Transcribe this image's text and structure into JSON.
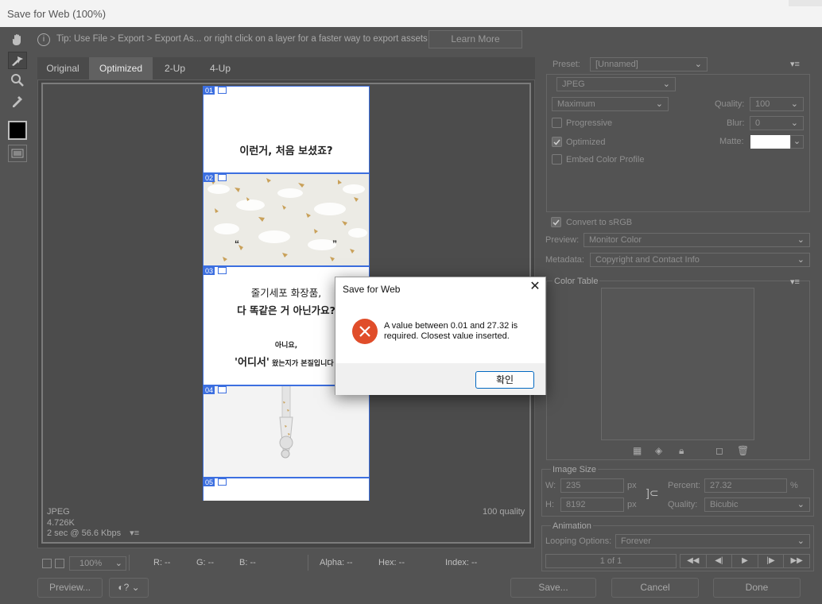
{
  "window": {
    "title": "Save for Web (100%)"
  },
  "tip": {
    "text": "Tip: Use File > Export > Export As...  or right click on a layer for a faster way to export assets",
    "learn_more": "Learn More"
  },
  "tabs": [
    "Original",
    "Optimized",
    "2-Up",
    "4-Up"
  ],
  "selected_tab": "Optimized",
  "canvas": {
    "slices": [
      "01",
      "02",
      "03",
      "04",
      "05"
    ],
    "text1": "이런거, 처음 보셨죠?",
    "text2a": "줄기세포 화장품,",
    "text2b": "다 똑같은 거 아닌가요?",
    "text3": "아니요,",
    "text4a": "'어디서'",
    "text4b": " 왔는지가 본질입니다",
    "quote_left": "“",
    "quote_right": "”"
  },
  "status": {
    "format": "JPEG",
    "size": "4.726K",
    "time": "2 sec @ 56.6 Kbps",
    "menu": "▾≡",
    "quality": "100 quality"
  },
  "bottom": {
    "zoom": "100%",
    "r": "R: --",
    "g": "G: --",
    "b": "B: --",
    "alpha": "Alpha: --",
    "hex": "Hex: --",
    "index": "Index: --"
  },
  "buttons": {
    "preview": "Preview...",
    "save": "Save...",
    "cancel": "Cancel",
    "done": "Done"
  },
  "right": {
    "preset_label": "Preset:",
    "preset_value": "[Unnamed]",
    "format": "JPEG",
    "compression": "Maximum",
    "quality_label": "Quality:",
    "quality_value": "100",
    "progressive": "Progressive",
    "blur_label": "Blur:",
    "blur_value": "0",
    "optimized": "Optimized",
    "matte_label": "Matte:",
    "embed": "Embed Color Profile",
    "convert": "Convert to sRGB",
    "preview_label": "Preview:",
    "preview_value": "Monitor Color",
    "metadata_label": "Metadata:",
    "metadata_value": "Copyright and Contact Info",
    "color_table": "Color Table",
    "image_size": "Image Size",
    "w_label": "W:",
    "w_value": "235",
    "h_label": "H:",
    "h_value": "8192",
    "px": "px",
    "percent_label": "Percent:",
    "percent_value": "27.32",
    "pct": "%",
    "resample_label": "Quality:",
    "resample_value": "Bicubic",
    "animation": "Animation",
    "looping_label": "Looping Options:",
    "looping_value": "Forever",
    "frame": "1 of 1"
  },
  "dialog": {
    "title": "Save for Web",
    "message": "A value between 0.01 and 27.32 is required. Closest value inserted.",
    "ok": "확인"
  }
}
